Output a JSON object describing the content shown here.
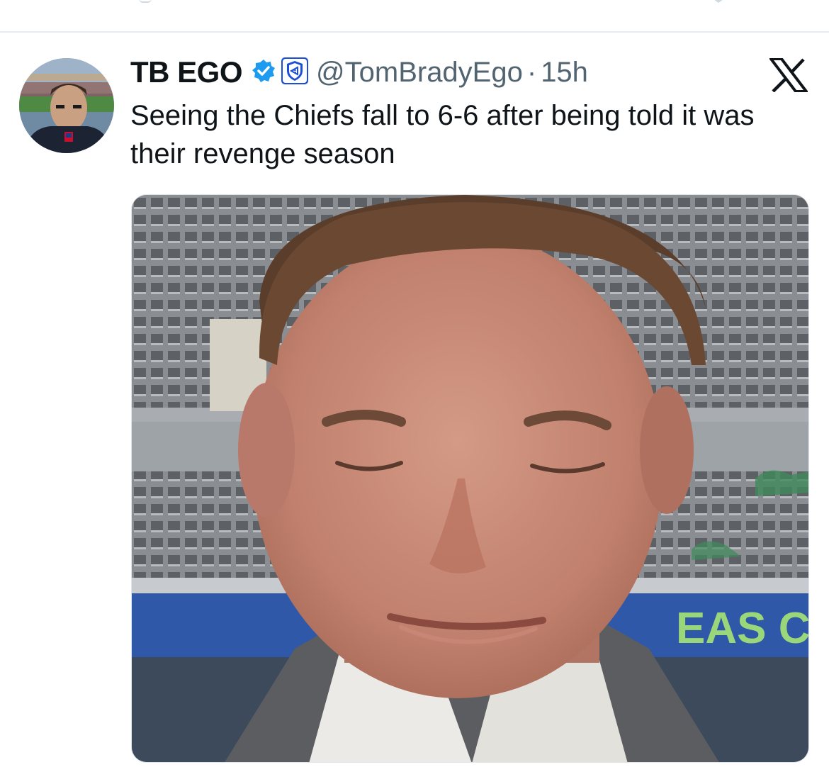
{
  "tweet": {
    "display_name": "TB EGO",
    "handle": "@TomBradyEgo",
    "separator": "·",
    "timestamp": "15h",
    "text": "Seeing the Chiefs fall to 6-6 after being told it was their revenge season",
    "badges": [
      "verified-check-icon",
      "affiliate-shield-icon"
    ],
    "source_icon": "x-logo-icon"
  },
  "media": {
    "stadium_sign_text": "EAS C"
  },
  "colors": {
    "verified_blue": "#1d9bf0",
    "text_primary": "#0f1419",
    "text_secondary": "#536471"
  }
}
